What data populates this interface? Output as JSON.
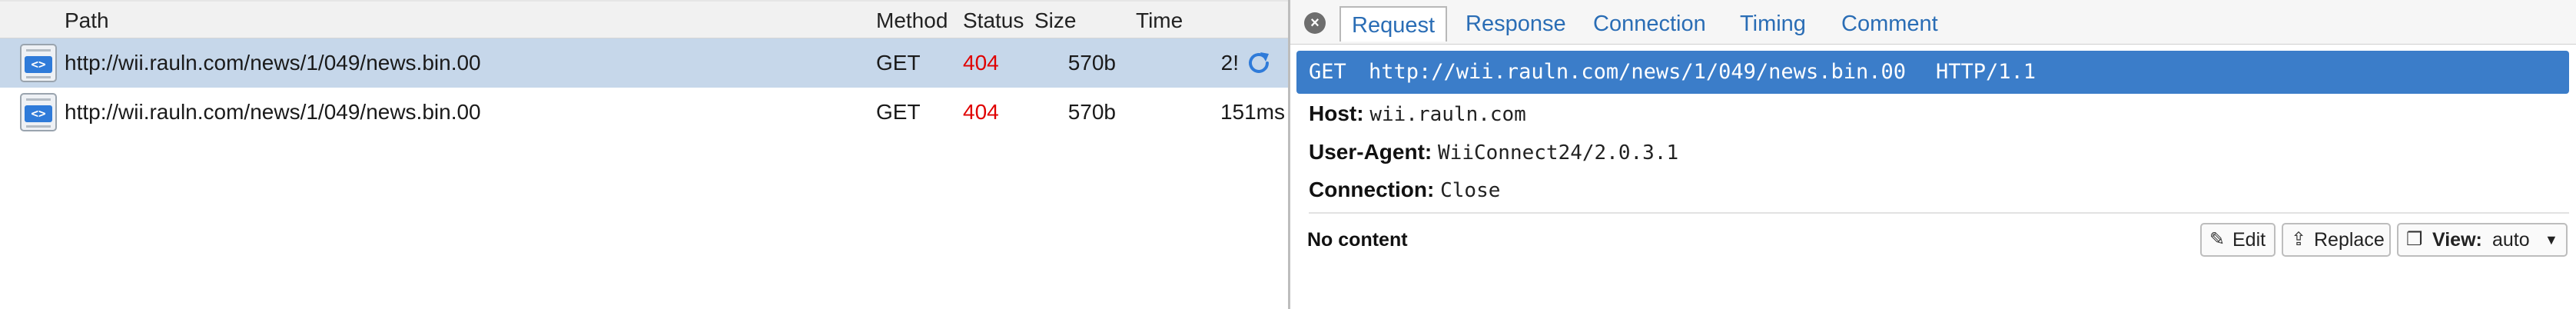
{
  "list": {
    "columns": [
      "Path",
      "Method",
      "Status",
      "Size",
      "Time"
    ],
    "rows": [
      {
        "path": "http://wii.rauln.com/news/1/049/news.bin.00",
        "method": "GET",
        "status": "404",
        "size": "570b",
        "time": "2!",
        "selected": true
      },
      {
        "path": "http://wii.rauln.com/news/1/049/news.bin.00",
        "method": "GET",
        "status": "404",
        "size": "570b",
        "time": "151ms",
        "selected": false
      }
    ]
  },
  "detail": {
    "tabs": [
      "Request",
      "Response",
      "Connection",
      "Timing",
      "Comment"
    ],
    "active_tab": "Request",
    "request_line": {
      "method": "GET",
      "url": "http://wii.rauln.com/news/1/049/news.bin.00",
      "version": "HTTP/1.1"
    },
    "headers": [
      {
        "key": "Host",
        "value": "wii.rauln.com"
      },
      {
        "key": "User-Agent",
        "value": "WiiConnect24/2.0.3.1"
      },
      {
        "key": "Connection",
        "value": "Close"
      }
    ],
    "body_label": "No content",
    "buttons": {
      "edit": "Edit",
      "replace": "Replace",
      "view_prefix": "View:",
      "view_value": "auto"
    }
  },
  "colors": {
    "selected_row": "#c6d7ea",
    "status_error": "#e00000",
    "request_bar": "#3b7dc9",
    "tab_text": "#2a6db5"
  },
  "icons": {
    "row_icon": "file-code-icon",
    "replay": "replay-icon",
    "close": "close-icon",
    "edit": "pencil-icon",
    "replace": "upload-icon",
    "view": "copy-icon",
    "dropdown": "caret-down-icon"
  }
}
